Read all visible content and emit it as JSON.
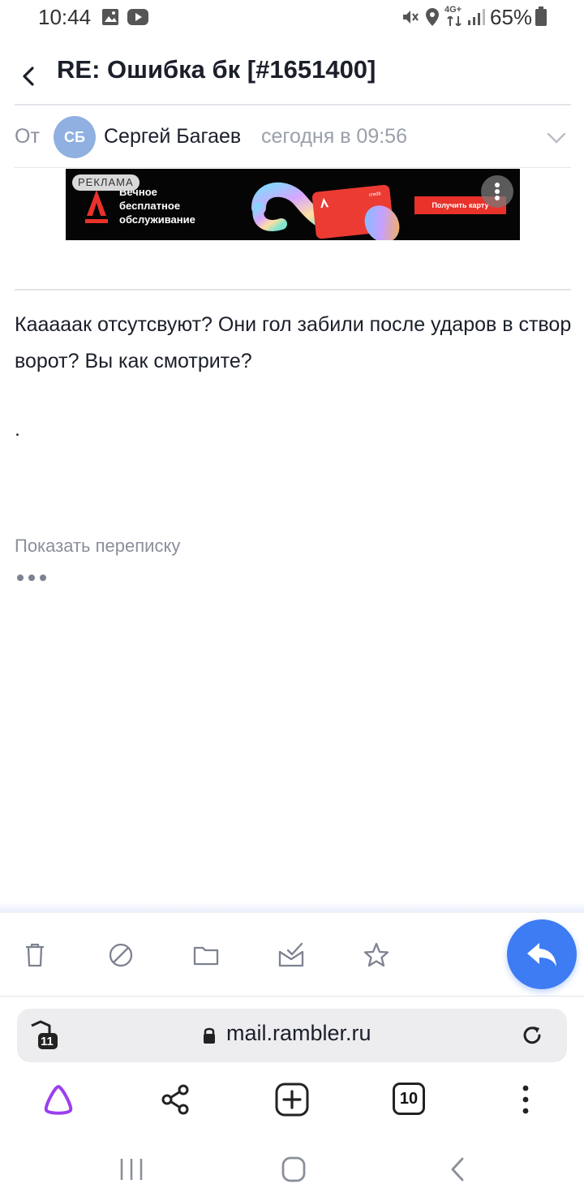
{
  "status_bar": {
    "time": "10:44",
    "network": "4G+",
    "battery": "65%"
  },
  "header": {
    "subject": "RE: Ошибка бк [#1651400]"
  },
  "sender": {
    "from_label": "От",
    "initials": "СБ",
    "name": "Сергей Багаев",
    "time": "сегодня в 09:56"
  },
  "ad": {
    "label": "РЕКЛАМА",
    "text": "Вечное\nбесплатное\nобслуживание",
    "cta": "Получить карту",
    "card_label": "credit",
    "accent": "#e8322a"
  },
  "message": {
    "body": "Каааaак отсутсвуют? Они гол забили после ударов в створ ворот? Вы как смотрите?",
    "dot": ".",
    "show_thread": "Показать переписку"
  },
  "actions": [
    {
      "icon": "trash-icon"
    },
    {
      "icon": "spam-icon"
    },
    {
      "icon": "folder-icon"
    },
    {
      "icon": "mark-read-icon"
    },
    {
      "icon": "star-icon"
    }
  ],
  "browser": {
    "tabs_shield_count": "11",
    "url": "mail.rambler.ru",
    "tab_count": "10"
  },
  "colors": {
    "accent": "#3d7cf2",
    "alice": "#9b3ff0",
    "avatar": "#8fb0e0"
  }
}
